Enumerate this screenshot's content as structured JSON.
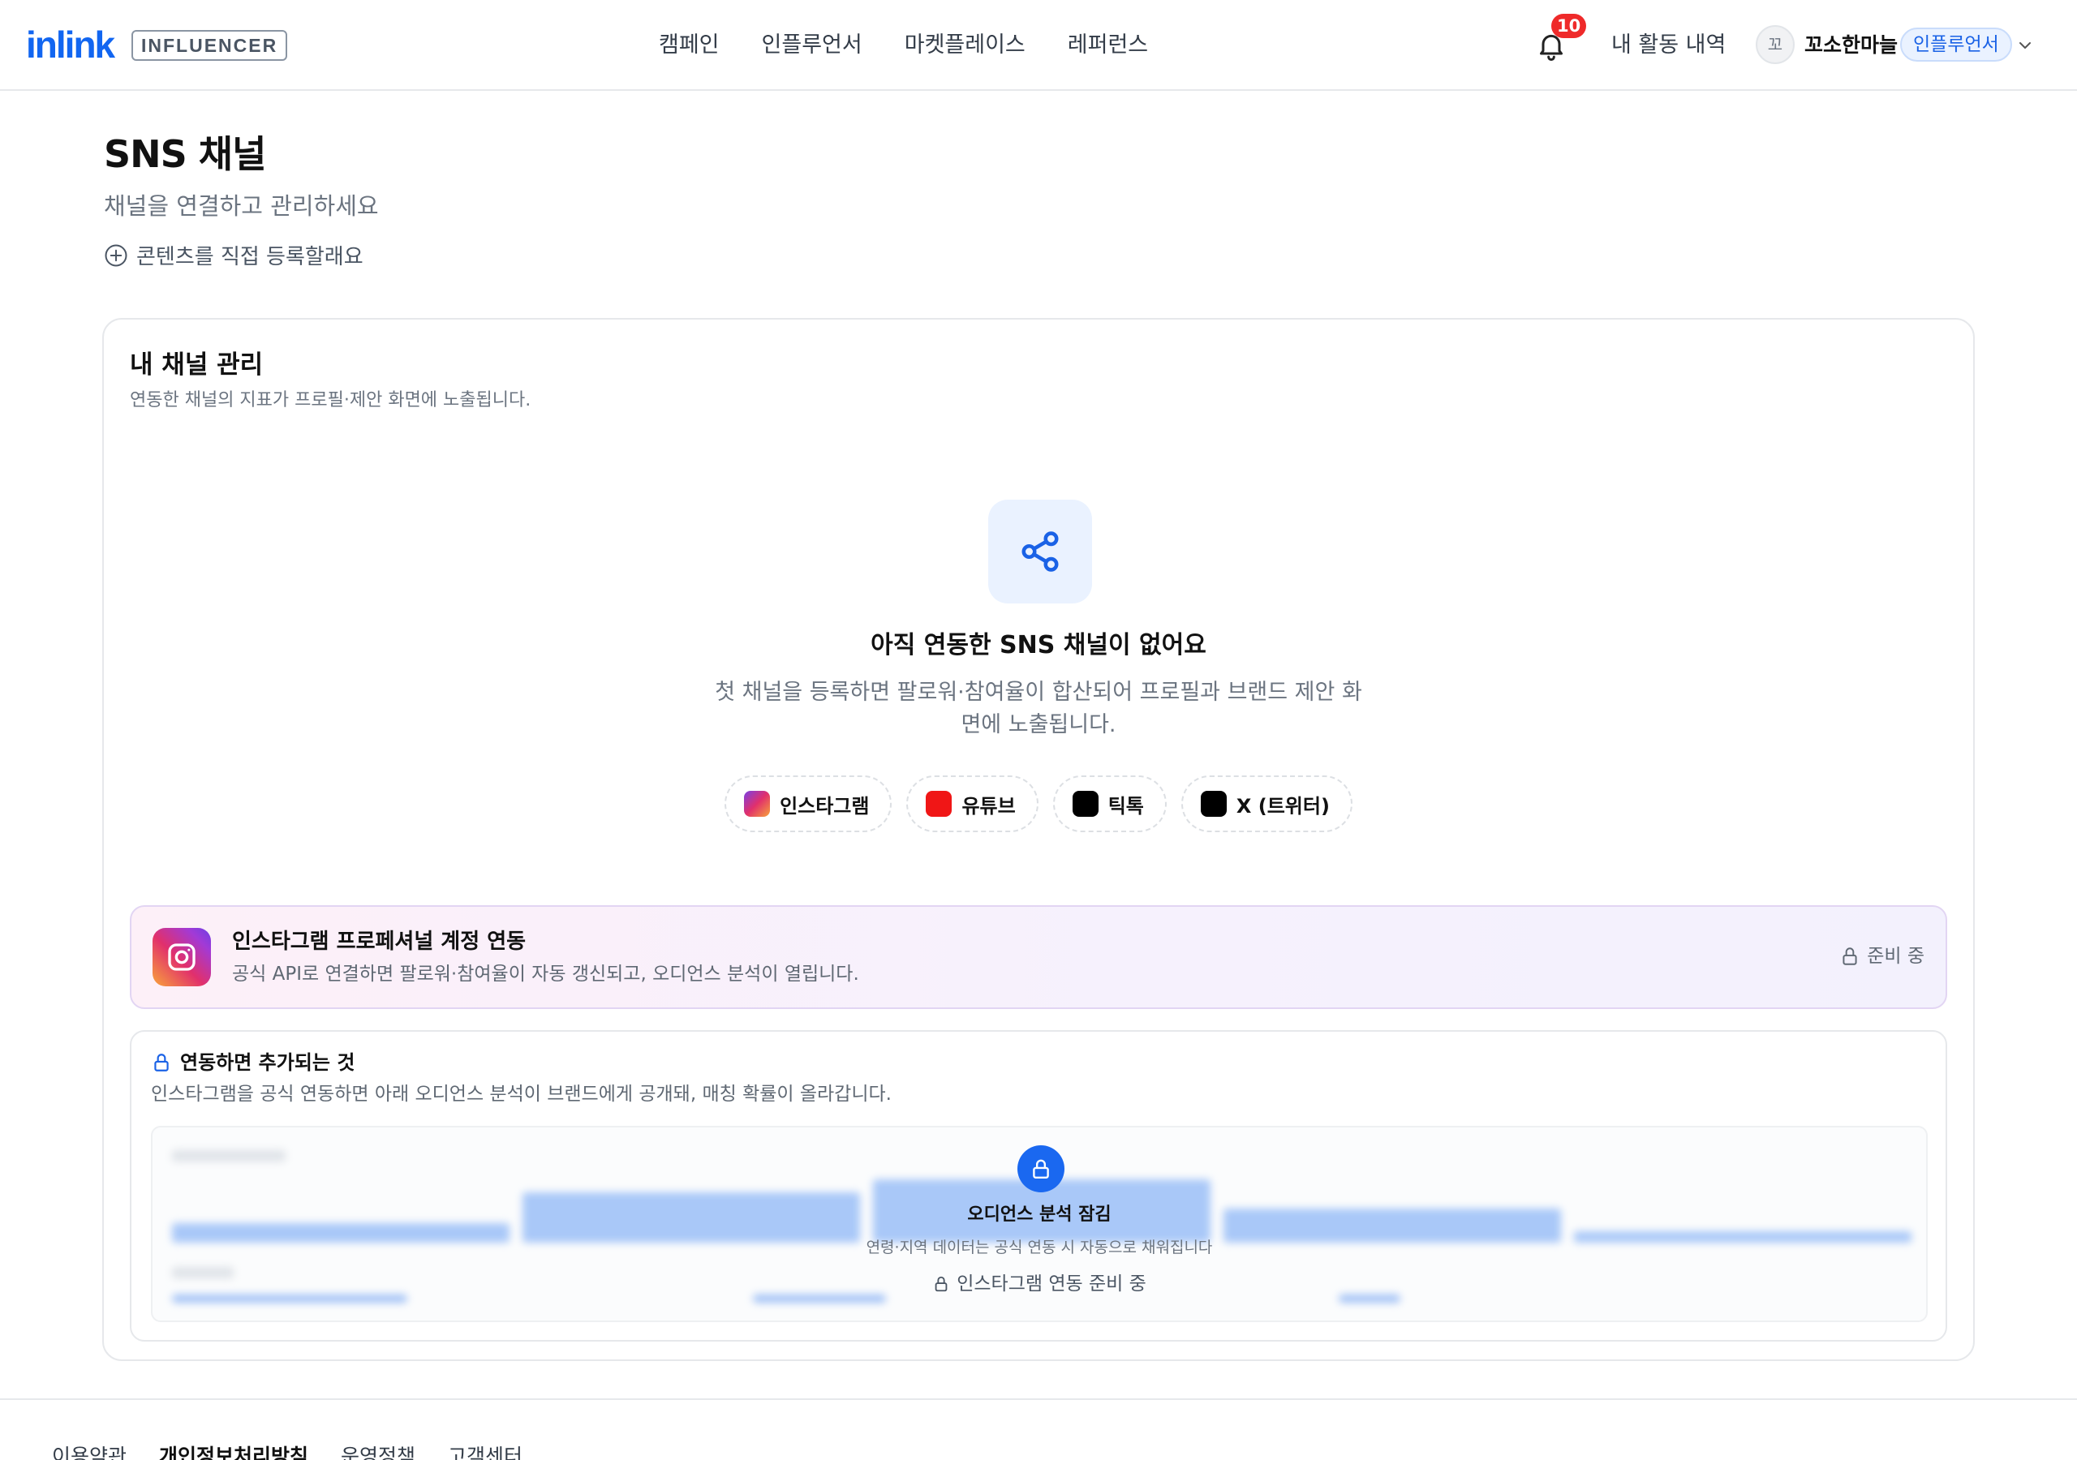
{
  "header": {
    "logo": "inlink",
    "logo_badge": "INFLUENCER",
    "nav": [
      "캠페인",
      "인플루언서",
      "마켓플레이스",
      "레퍼런스"
    ],
    "notification_count": "10",
    "activity_label": "내 활동 내역",
    "avatar_initial": "꼬",
    "username": "꼬소한마늘",
    "role_badge": "인플루언서"
  },
  "page": {
    "title": "SNS 채널",
    "subtitle": "채널을 연결하고 관리하세요",
    "direct_register": "콘텐츠를 직접 등록할래요"
  },
  "card": {
    "title": "내 채널 관리",
    "subtitle": "연동한 채널의 지표가 프로필·제안 화면에 노출됩니다.",
    "empty_title": "아직 연동한 SNS 채널이 없어요",
    "empty_desc": "첫 채널을 등록하면 팔로워·참여율이 합산되어 프로필과 브랜드 제안 화면에 노출됩니다.",
    "channels": [
      {
        "label": "인스타그램",
        "icon": "instagram-icon"
      },
      {
        "label": "유튜브",
        "icon": "youtube-icon"
      },
      {
        "label": "틱톡",
        "icon": "tiktok-icon"
      },
      {
        "label": "X (트위터)",
        "icon": "x-icon"
      }
    ]
  },
  "ig_banner": {
    "title": "인스타그램 프로페셔널 계정 연동",
    "desc": "공식 API로 연결하면 팔로워·참여율이 자동 갱신되고, 오디언스 분석이 열립니다.",
    "status": "준비 중"
  },
  "locked": {
    "title": "연동하면 추가되는 것",
    "desc": "인스타그램을 공식 연동하면 아래 오디언스 분석이 브랜드에게 공개돼, 매칭 확률이 올라갑니다.",
    "overlay_title": "오디언스 분석 잠김",
    "overlay_desc": "연령·지역 데이터는 공식 연동 시 자동으로 채워집니다",
    "overlay_pending": "인스타그램 연동 준비 중"
  },
  "footer": {
    "links": [
      "이용약관",
      "개인정보처리방침",
      "운영정책",
      "고객센터"
    ]
  },
  "colors": {
    "accent": "#1266f1",
    "badge_red": "#ef2a2a",
    "youtube": "#f01616"
  }
}
